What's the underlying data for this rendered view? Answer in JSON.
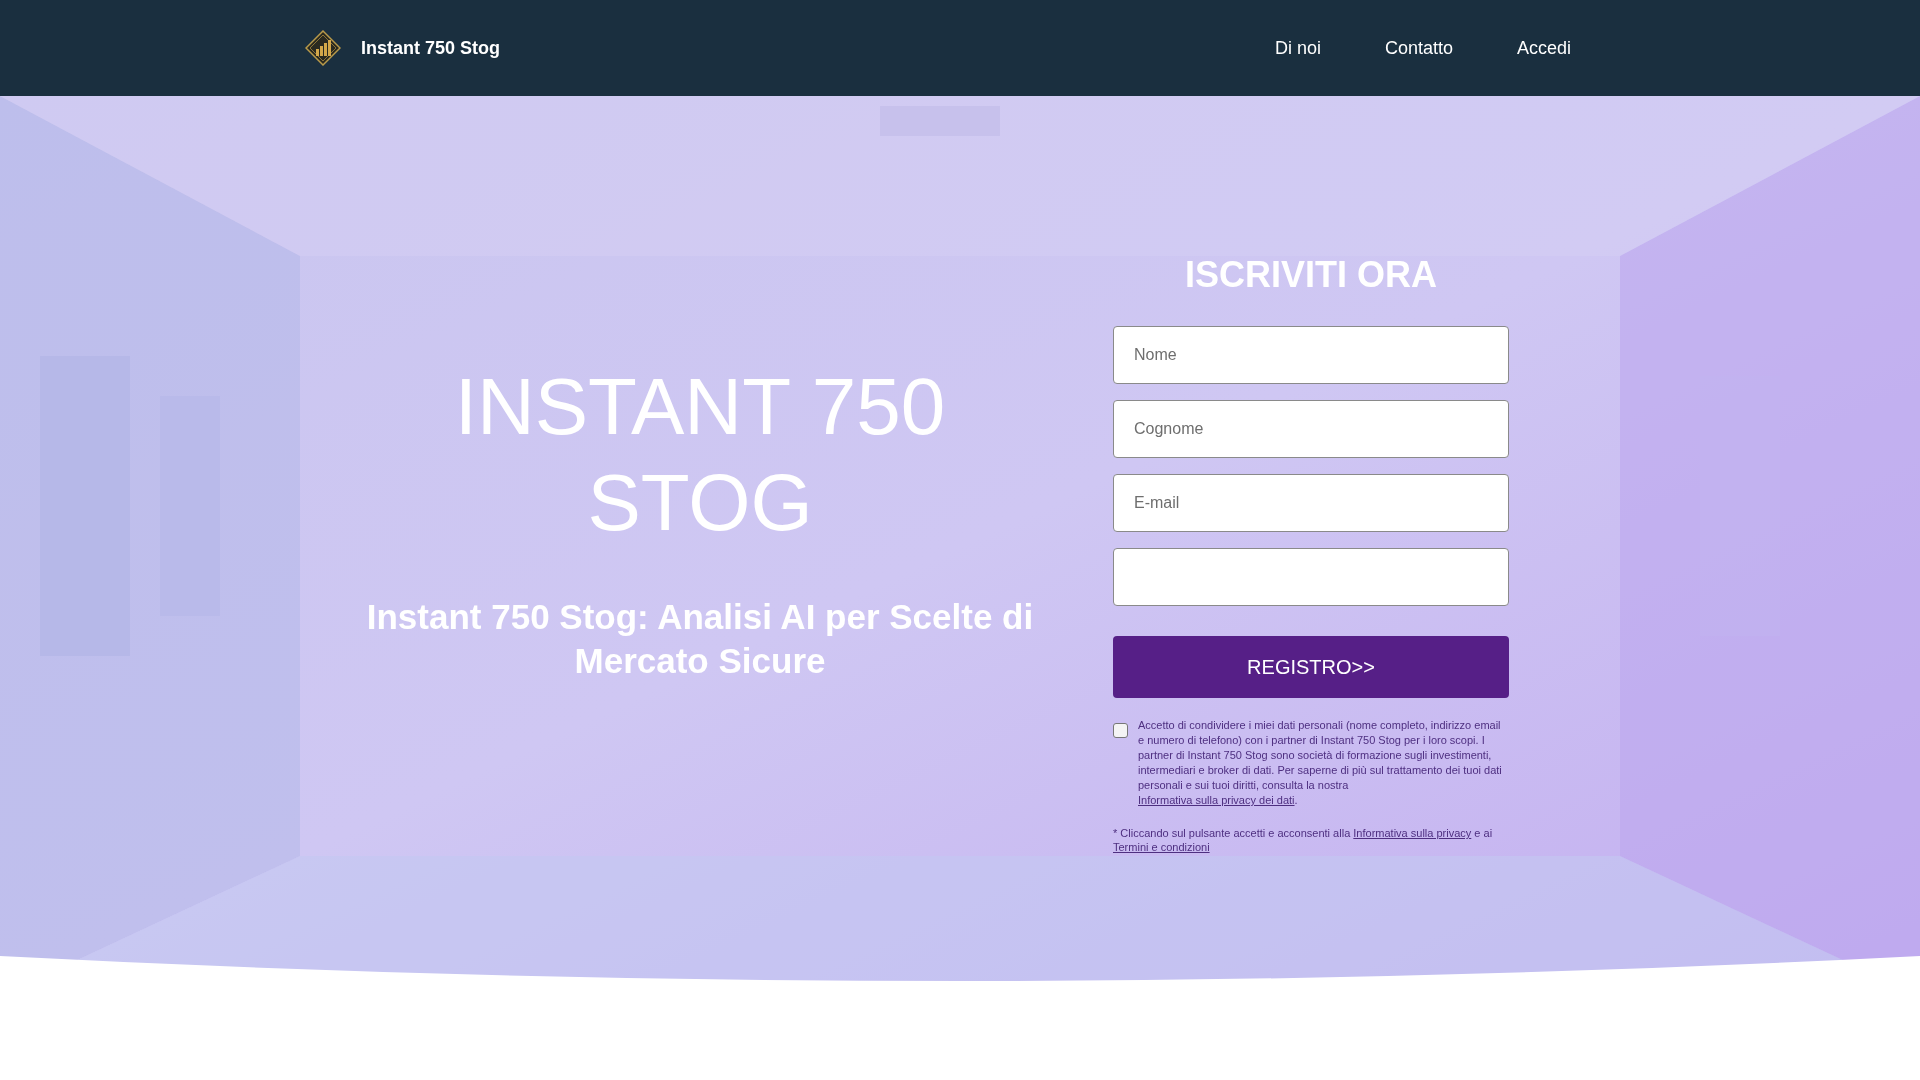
{
  "header": {
    "brand": "Instant 750 Stog",
    "nav": [
      {
        "label": "Di noi"
      },
      {
        "label": "Contatto"
      },
      {
        "label": "Accedi"
      }
    ]
  },
  "hero": {
    "kind": "picture",
    "title": "INSTANT 750 STOG",
    "subtitle": "Instant 750 Stog: Analisi AI per Scelte di Mercato Sicure"
  },
  "form": {
    "title": "ISCRIVITI ORA",
    "fields": [
      {
        "kind": "text",
        "placeholder": "Nome"
      },
      {
        "kind": "text",
        "placeholder": "Cognome"
      },
      {
        "kind": "text",
        "placeholder": "E-mail"
      },
      {
        "kind": "text"
      }
    ],
    "button": "REGISTRO>>",
    "consent": {
      "checked": false,
      "text": "Accetto di condividere i miei dati personali (nome completo, indirizzo email e numero di telefono) con i partner di Instant 750 Stog per i loro scopi. I partner di Instant 750 Stog sono società di formazione sugli investimenti, intermediari e broker di dati. Per saperne di più sul trattamento dei tuoi dati personali e sui tuoi diritti, consulta la nostra",
      "link": "Informativa sulla privacy dei dati",
      "end": "."
    },
    "note": {
      "text": "* Cliccando sul pulsante accetti e acconsenti alla",
      "link": "Informativa sulla privacy",
      "middle": "e ai",
      "link2": "Termini e condizioni"
    }
  }
}
